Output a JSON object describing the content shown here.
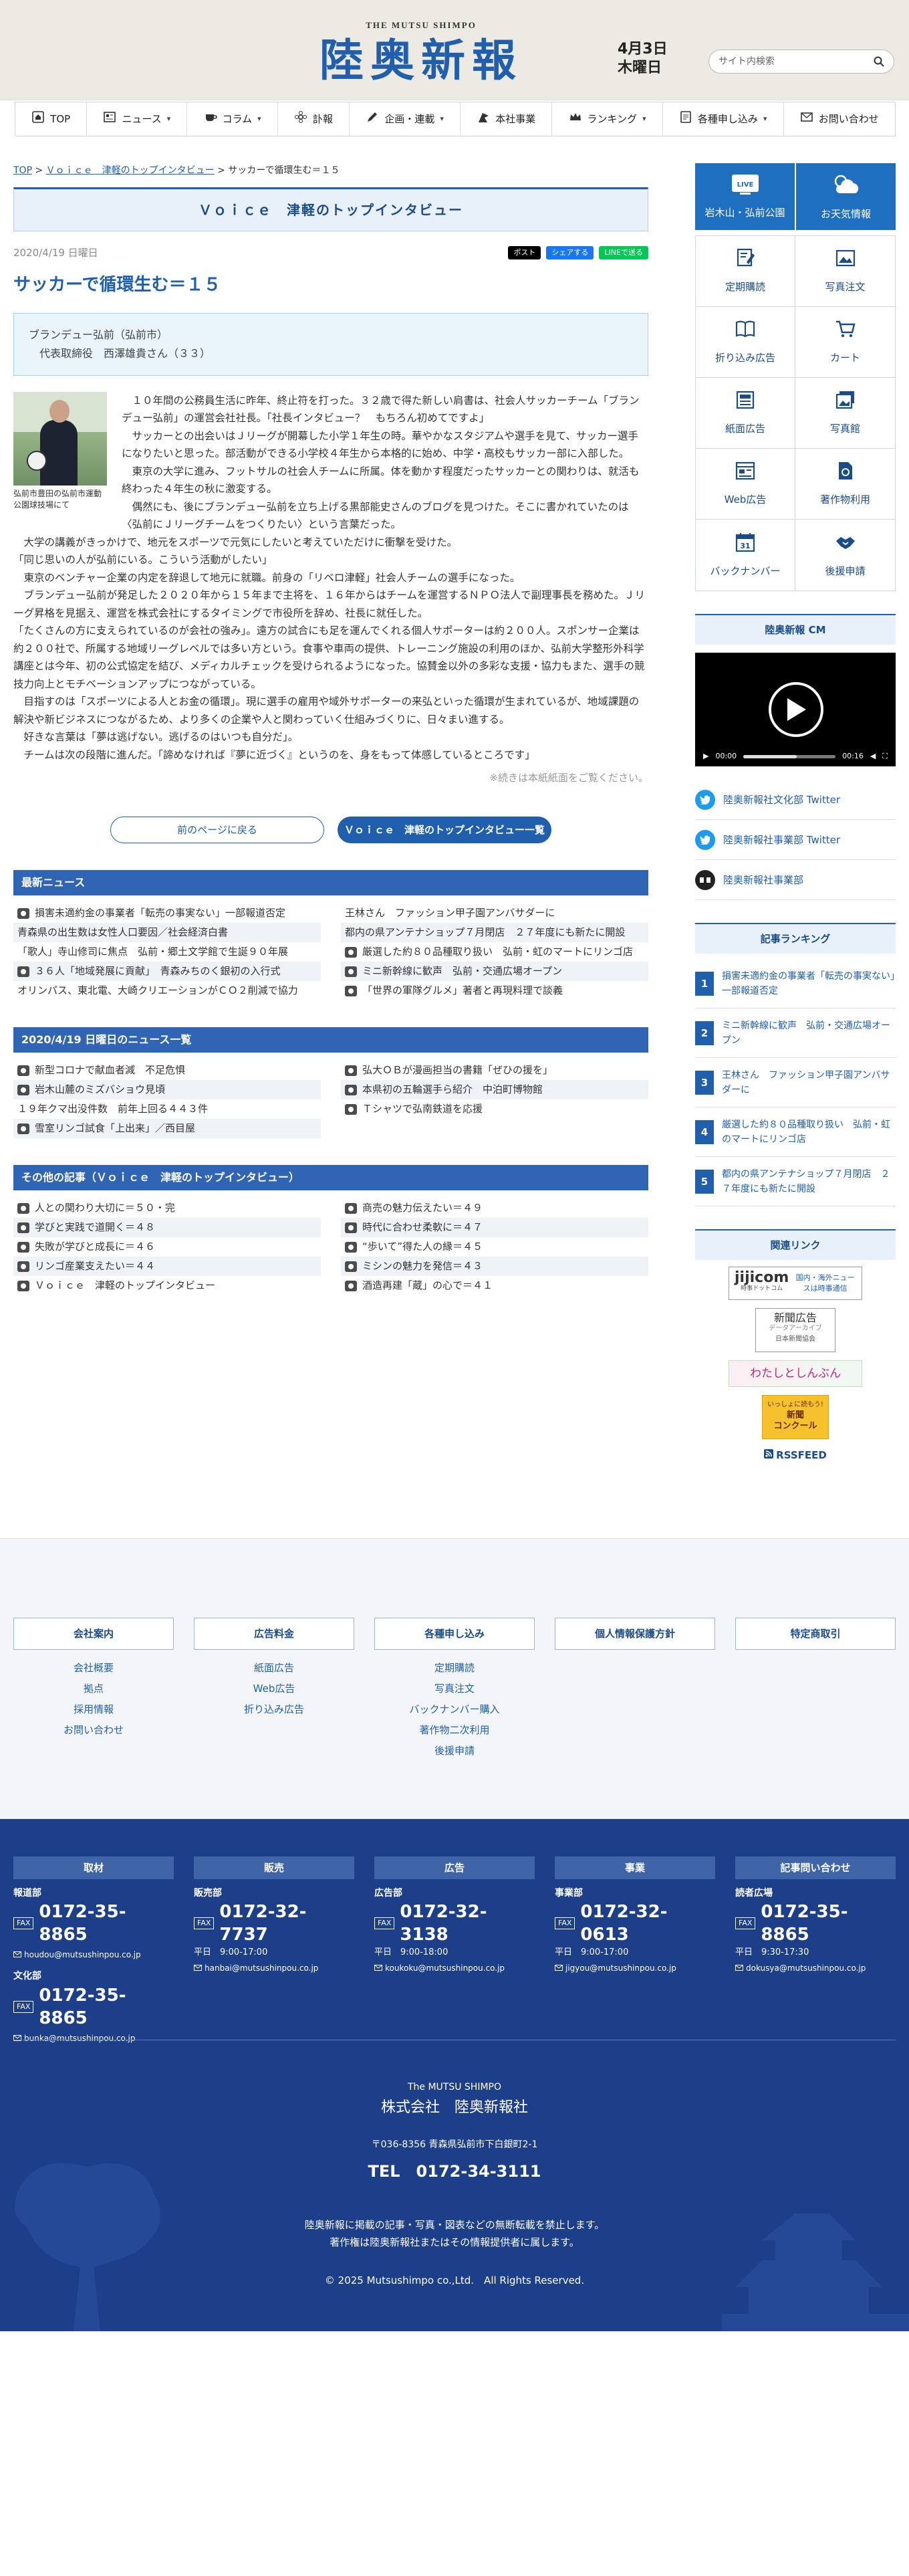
{
  "header": {
    "brand_en": "THE MUTSU SHIMPO",
    "brand_jp": "陸奥新報",
    "date": "4月3日",
    "weekday": "木曜日",
    "search_placeholder": "サイト内検索"
  },
  "nav": [
    {
      "label": "TOP",
      "icon": "home-icon"
    },
    {
      "label": "ニュース",
      "icon": "news-icon",
      "caret": "▾"
    },
    {
      "label": "コラム",
      "icon": "cup-icon",
      "caret": "▾"
    },
    {
      "label": "訃報",
      "icon": "flower-icon"
    },
    {
      "label": "企画・連載",
      "icon": "pen-icon",
      "caret": "▾"
    },
    {
      "label": "本社事業",
      "icon": "flag-icon"
    },
    {
      "label": "ランキング",
      "icon": "crown-icon",
      "caret": "▾"
    },
    {
      "label": "各種申し込み",
      "icon": "form-icon",
      "caret": "▾"
    },
    {
      "label": "お問い合わせ",
      "icon": "mail-icon"
    }
  ],
  "breadcrumb": {
    "home": "TOP",
    "sep": ">",
    "category": "Ｖｏｉｃｅ　津軽のトップインタビュー",
    "current": "サッカーで循環生む＝１５"
  },
  "category_title": "Ｖｏｉｃｅ　津軽のトップインタビュー",
  "article": {
    "date": "2020/4/19 日曜日",
    "share": [
      "ポスト",
      "シェアする",
      "LINEで送る"
    ],
    "title": "サッカーで循環生む＝１５",
    "person_org": "ブランデュー弘前（弘前市）",
    "person_name": "代表取締役　西澤雄貴さん（３３）",
    "photo_caption": "弘前市豊田の弘前市運動公園球技場にて",
    "paragraphs": [
      "　１０年間の公務員生活に昨年、終止符を打った。３２歳で得た新しい肩書は、社会人サッカーチーム「ブランデュー弘前」の運営会社社長。「社長インタビュー？　もちろん初めてですよ」",
      "　サッカーとの出会いはＪリーグが開幕した小学１年生の時。華やかなスタジアムや選手を見て、サッカー選手になりたいと思った。部活動ができる小学校４年生から本格的に始め、中学・高校もサッカー部に入部した。",
      "　東京の大学に進み、フットサルの社会人チームに所属。体を動かす程度だったサッカーとの関わりは、就活も終わった４年生の秋に激変する。",
      "　偶然にも、後にブランデュー弘前を立ち上げる黒部能史さんのブログを見つけた。そこに書かれていたのは〈弘前にＪリーグチームをつくりたい〉という言葉だった。",
      "　大学の講義がきっかけで、地元をスポーツで元気にしたいと考えていただけに衝撃を受けた。",
      "「同じ思いの人が弘前にいる。こういう活動がしたい」",
      "　東京のベンチャー企業の内定を辞退して地元に就職。前身の「リベロ津軽」社会人チームの選手になった。",
      "　ブランデュー弘前が発足した２０２０年から１５年まで主将を、１６年からはチームを運営するＮＰＯ法人で副理事長を務めた。Ｊリーグ昇格を見据え、運営を株式会社にするタイミングで市役所を辞め、社長に就任した。",
      "「たくさんの方に支えられているのが会社の強み」。遠方の試合にも足を運んでくれる個人サポーターは約２００人。スポンサー企業は約２００社で、所属する地域リーグレベルでは多い方という。食事や車両の提供、トレーニング施設の利用のほか、弘前大学整形外科学講座とは今年、初の公式協定を結び、メディカルチェックを受けられるようになった。協賛金以外の多彩な支援・協力もまた、選手の競技力向上とモチベーションアップにつながっている。",
      "　目指すのは「スポーツによる人とお金の循環」。現に選手の雇用や域外サポーターの来弘といった循環が生まれているが、地域課題の解決や新ビジネスにつながるため、より多くの企業や人と関わっていく仕組みづくりに、日々まい進する。",
      "　好きな言葉は「夢は逃げない。逃げるのはいつも自分だ」。",
      "　チームは次の段階に進んだ。「諦めなければ『夢に近づく』というのを、身をもって体感しているところです」"
    ],
    "note": "※続きは本紙紙面をご覧ください。"
  },
  "buttons": {
    "back": "前のページに戻る",
    "list": "Ｖｏｉｃｅ　津軽のトップインタビュー一覧"
  },
  "latest": {
    "title": "最新ニュース",
    "items": [
      {
        "text": "損害未適約金の事業者「転売の事実ない」一部報道否定",
        "cam": true
      },
      {
        "text": "王林さん　ファッション甲子園アンバサダーに",
        "cam": false
      },
      {
        "text": "青森県の出生数は女性人口要因／社会経済白書",
        "cam": false
      },
      {
        "text": "都内の県アンテナショップ７月閉店　２７年度にも新たに開設",
        "cam": false
      },
      {
        "text": "「歌人」寺山修司に焦点　弘前・郷土文学館で生誕９０年展",
        "cam": false
      },
      {
        "text": "厳選した約８０品種取り扱い　弘前・虹のマートにリンゴ店",
        "cam": true
      },
      {
        "text": "３６人「地域発展に貢献」　青森みちのく銀初の入行式",
        "cam": true
      },
      {
        "text": "ミニ新幹線に歓声　弘前・交通広場オープン",
        "cam": true
      },
      {
        "text": "オリンパス、東北電、大崎クリエーションがＣＯ２削減で協力",
        "cam": false
      },
      {
        "text": "「世界の軍隊グルメ」著者と再現料理で談義",
        "cam": true
      }
    ]
  },
  "sameday": {
    "title": "2020/4/19 日曜日のニュース一覧",
    "items": [
      {
        "text": "新型コロナで献血者減　不足危惧",
        "cam": true
      },
      {
        "text": "弘大ＯＢが漫画担当の書籍「ぜひの援を」",
        "cam": true
      },
      {
        "text": "岩木山麓のミズバショウ見頃",
        "cam": true
      },
      {
        "text": "本県初の五輪選手ら紹介　中泊町博物館",
        "cam": true
      },
      {
        "text": "１９年クマ出没件数　前年上回る４４３件",
        "cam": false
      },
      {
        "text": "Ｔシャツで弘南鉄道を応援",
        "cam": true
      },
      {
        "text": "雪室リンゴ試食「上出来」／西目屋",
        "cam": true
      }
    ]
  },
  "others": {
    "title": "その他の記事（Ｖｏｉｃｅ　津軽のトップインタビュー）",
    "items": [
      {
        "text": "人との関わり大切に＝５０・完",
        "cam": true
      },
      {
        "text": "商売の魅力伝えたい＝４９",
        "cam": true
      },
      {
        "text": "学びと実践で道開く＝４８",
        "cam": true
      },
      {
        "text": "時代に合わせ柔軟に＝４７",
        "cam": true
      },
      {
        "text": "失敗が学びと成長に＝４６",
        "cam": true
      },
      {
        "text": "“歩いて”得た人の縁＝４５",
        "cam": true
      },
      {
        "text": "リンゴ産業支えたい＝４４",
        "cam": true
      },
      {
        "text": "ミシンの魅力を発信＝４３",
        "cam": true
      },
      {
        "text": "Ｖｏｉｃｅ　津軽のトップインタビュー",
        "cam": true
      },
      {
        "text": "酒造再建「蔵」の心で＝４１",
        "cam": true
      }
    ]
  },
  "sidebar": {
    "live": {
      "badge": "LIVE",
      "label": "岩木山・弘前公園"
    },
    "weather": "お天気情報",
    "tiles": [
      {
        "label": "定期購読",
        "icon": "subscribe-icon"
      },
      {
        "label": "写真注文",
        "icon": "photo-icon"
      },
      {
        "label": "折り込み広告",
        "icon": "book-icon"
      },
      {
        "label": "カート",
        "icon": "cart-icon"
      },
      {
        "label": "紙面広告",
        "icon": "newspaper-icon"
      },
      {
        "label": "写真館",
        "icon": "gallery-icon"
      },
      {
        "label": "Web広告",
        "icon": "web-ad-icon"
      },
      {
        "label": "著作物利用",
        "icon": "copyright-icon"
      },
      {
        "label": "バックナンバー",
        "icon": "calendar-icon",
        "number": "31"
      },
      {
        "label": "後援申請",
        "icon": "handshake-icon"
      }
    ],
    "cm_title": "陸奥新報 CM",
    "video": {
      "time_start": "00:00",
      "time_end": "00:16"
    },
    "sns": [
      {
        "label": "陸奥新報社文化部 Twitter",
        "icon": "twitter-icon"
      },
      {
        "label": "陸奥新報社事業部 Twitter",
        "icon": "twitter-icon"
      },
      {
        "label": "陸奥新報社事業部",
        "icon": "event-icon"
      }
    ],
    "ranking_title": "記事ランキング",
    "ranking": [
      {
        "n": "1",
        "text": "損害未適約金の事業者「転売の事実ない」一部報道否定"
      },
      {
        "n": "2",
        "text": "ミニ新幹線に歓声　弘前・交通広場オープン"
      },
      {
        "n": "3",
        "text": "王林さん　ファッション甲子園アンバサダーに"
      },
      {
        "n": "4",
        "text": "厳選した約８０品種取り扱い　弘前・虹のマートにリンゴ店"
      },
      {
        "n": "5",
        "text": "都内の県アンテナショップ７月閉店　２７年度にも新たに開設"
      }
    ],
    "links_title": "関連リンク",
    "links": {
      "jiji_main": "jijicom",
      "jiji_side": "国内・海外ニュースは時事通信",
      "jiji_sub": "時事ドットコム",
      "archive_main": "新聞広告",
      "archive_sub": "データアーカイブ",
      "archive_org": "日本新聞協会",
      "watashi": "わたしとしんぶん",
      "contest_line1": "いっしょに読もう!",
      "contest_line2": "新聞",
      "contest_line3": "コンクール"
    },
    "rss": "RSSFEED"
  },
  "footer": {
    "cols": [
      {
        "head": "会社案内",
        "links": [
          "会社概要",
          "拠点",
          "採用情報",
          "お問い合わせ"
        ]
      },
      {
        "head": "広告料金",
        "links": [
          "紙面広告",
          "Web広告",
          "折り込み広告"
        ]
      },
      {
        "head": "各種申し込み",
        "links": [
          "定期購読",
          "写真注文",
          "バックナンバー購入",
          "著作物二次利用",
          "後援申請"
        ]
      },
      {
        "head": "個人情報保護方針",
        "links": []
      },
      {
        "head": "特定商取引",
        "links": []
      }
    ],
    "depts": [
      {
        "head": "取材",
        "sub": "報道部",
        "fax": "FAX",
        "tel": "0172-35-8865",
        "hours": "",
        "mail": "houdou@mutsushinpou.co.jp",
        "extra": {
          "sub": "文化部",
          "fax": "FAX",
          "tel": "0172-35-8865",
          "mail": "bunka@mutsushinpou.co.jp"
        }
      },
      {
        "head": "販売",
        "sub": "販売部",
        "fax": "FAX",
        "tel": "0172-32-7737",
        "hours": "平日　9:00-17:00",
        "mail": "hanbai@mutsushinpou.co.jp"
      },
      {
        "head": "広告",
        "sub": "広告部",
        "fax": "FAX",
        "tel": "0172-32-3138",
        "hours": "平日　9:00-18:00",
        "mail": "koukoku@mutsushinpou.co.jp"
      },
      {
        "head": "事業",
        "sub": "事業部",
        "fax": "FAX",
        "tel": "0172-32-0613",
        "hours": "平日　9:00-17:00",
        "mail": "jigyou@mutsushinpou.co.jp"
      },
      {
        "head": "記事問い合わせ",
        "sub": "読者広場",
        "fax": "FAX",
        "tel": "0172-35-8865",
        "hours": "平日　9:30-17:30",
        "mail": "dokusya@mutsushinpou.co.jp"
      }
    ],
    "company_en": "The MUTSU SHIMPO",
    "company_jp": "株式会社　陸奥新報社",
    "address": "〒036-8356 青森県弘前市下白銀町2-1",
    "tel": "TEL　0172-34-3111",
    "note1": "陸奥新報に掲載の記事・写真・図表などの無断転載を禁止します。",
    "note2": "著作権は陸奥新報社またはその情報提供者に属します。",
    "copyright": "© 2025 Mutsushimpo co.,Ltd.　All Rights Reserved."
  },
  "colors": {
    "brand": "#1f5fae",
    "section": "#3064b5",
    "footer_bg": "#1d3f8a"
  }
}
